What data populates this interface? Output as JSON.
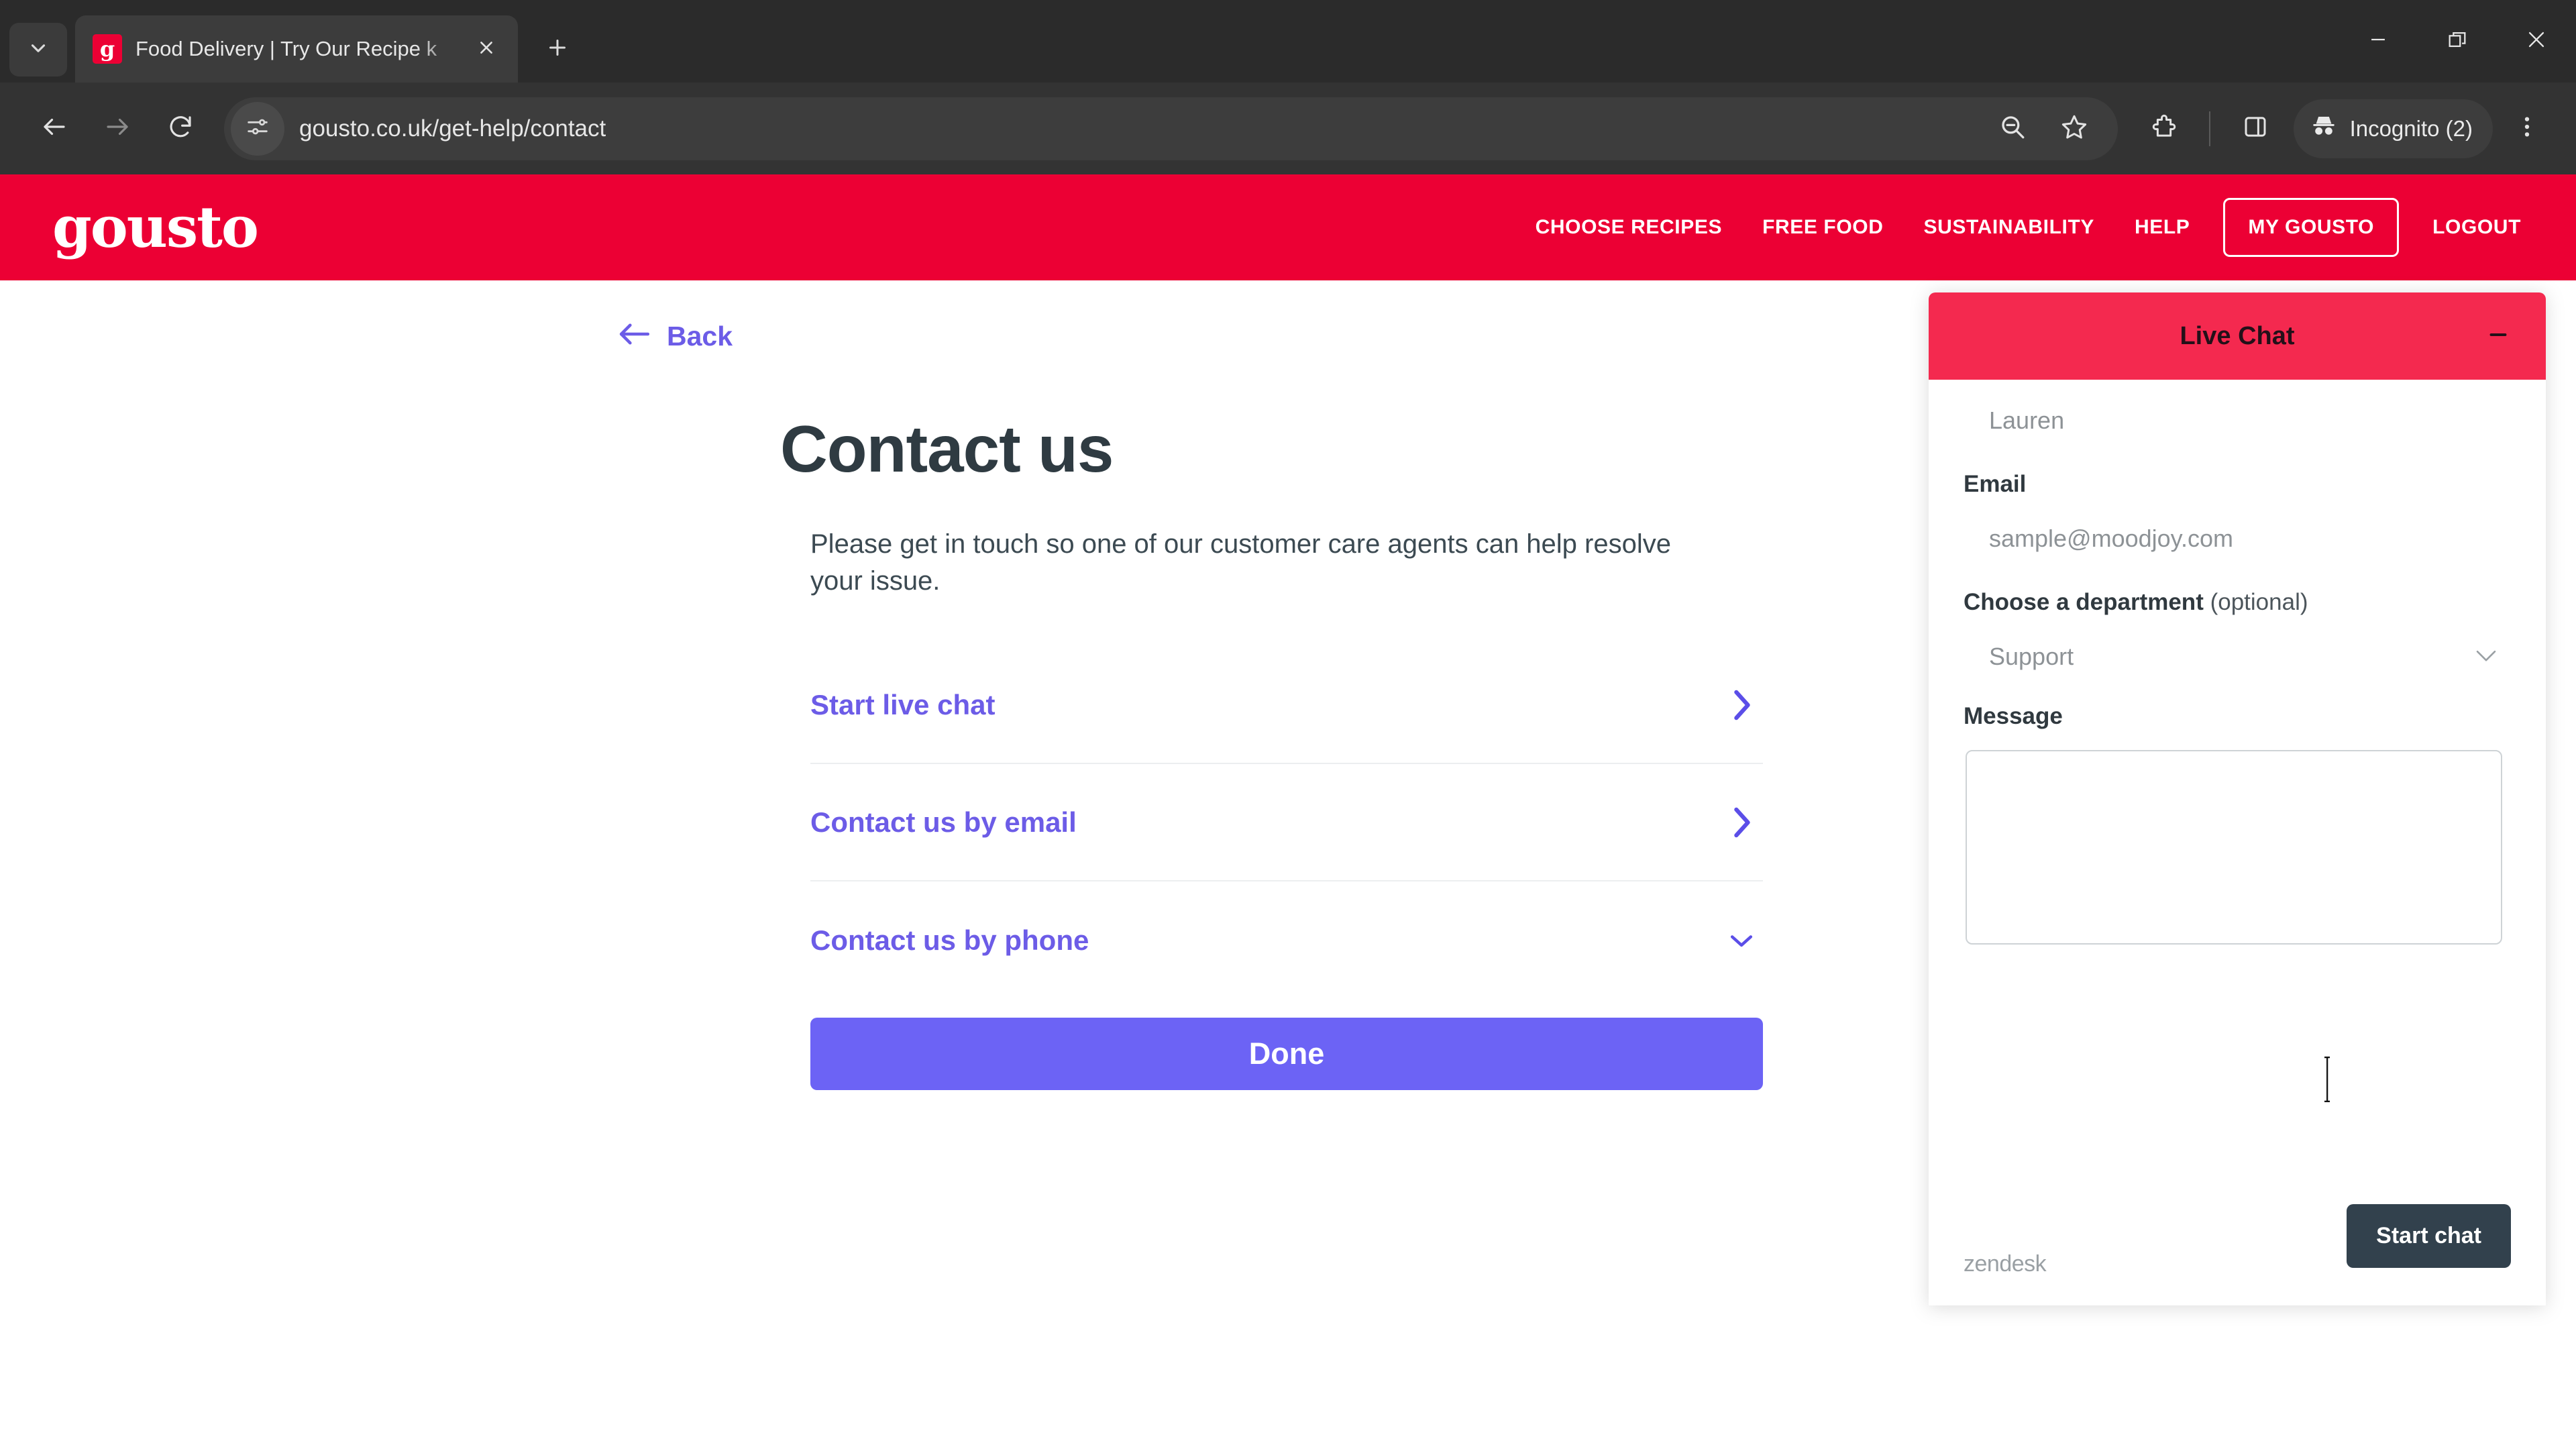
{
  "browser": {
    "tab": {
      "title": "Food Delivery | Try Our Recipe k",
      "favicon_letter": "g",
      "close_icon": "close-icon"
    },
    "new_tab_icon": "plus-icon",
    "tab_search_icon": "chevron-down-icon",
    "window_controls": {
      "minimize": "minimize-icon",
      "restore": "restore-icon",
      "close": "close-icon"
    },
    "toolbar": {
      "back_icon": "arrow-left-icon",
      "forward_icon": "arrow-right-icon",
      "reload_icon": "reload-icon",
      "site_info_icon": "tune-icon",
      "url": "gousto.co.uk/get-help/contact",
      "zoom_out_icon": "zoom-out-icon",
      "bookmark_icon": "star-icon",
      "extensions_icon": "extensions-puzzle-icon",
      "side_panel_icon": "side-panel-icon",
      "profile_icon": "incognito-icon",
      "profile_label": "Incognito (2)",
      "menu_icon": "kebab-menu-icon"
    }
  },
  "site_nav": {
    "logo": "gousto",
    "links": [
      "CHOOSE RECIPES",
      "FREE FOOD",
      "SUSTAINABILITY",
      "HELP"
    ],
    "my_account": "MY GOUSTO",
    "logout": "LOGOUT",
    "brand_color": "#ec0034"
  },
  "page": {
    "back_label": "Back",
    "title": "Contact us",
    "intro": "Please get in touch so one of our customer care agents can help resolve your issue.",
    "options": [
      {
        "label": "Start live chat",
        "icon": "chevron-right-icon"
      },
      {
        "label": "Contact us by email",
        "icon": "chevron-right-icon"
      },
      {
        "label": "Contact us by phone",
        "icon": "chevron-down-icon"
      }
    ],
    "done_label": "Done",
    "accent_color": "#6c5ce7",
    "button_color": "#6c63f5"
  },
  "chat_widget": {
    "header_title": "Live Chat",
    "header_color": "#f4294f",
    "minimize_icon": "minimize-icon",
    "name_value": "Lauren",
    "email_label": "Email",
    "email_value": "sample@moodjoy.com",
    "department_label": "Choose a department",
    "department_optional": " (optional)",
    "department_value": "Support",
    "department_icon": "chevron-down-icon",
    "message_label": "Message",
    "message_value": "",
    "brand_mark": "zendesk",
    "start_chat_label": "Start chat",
    "start_chat_color": "#32414d"
  }
}
